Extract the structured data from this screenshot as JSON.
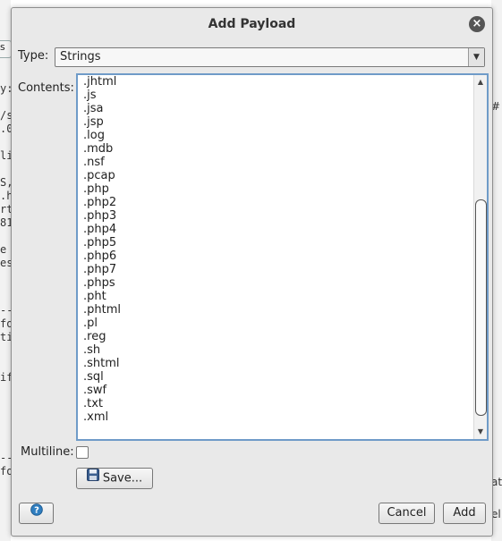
{
  "dialog": {
    "title": "Add Payload",
    "close_symbol": "×"
  },
  "type_field": {
    "label": "Type:",
    "value": "Strings",
    "arrow": "▼"
  },
  "contents": {
    "label": "Contents:",
    "items": [
      ".jhtml",
      ".js",
      ".jsa",
      ".jsp",
      ".log",
      ".mdb",
      ".nsf",
      ".pcap",
      ".php",
      ".php2",
      ".php3",
      ".php4",
      ".php5",
      ".php6",
      ".php7",
      ".phps",
      ".pht",
      ".phtml",
      ".pl",
      ".reg",
      ".sh",
      ".shtml",
      ".sql",
      ".swf",
      ".txt",
      ".xml"
    ],
    "scroll_up": "▲",
    "scroll_down": "▼",
    "scroll_fraction": 0.6
  },
  "multiline": {
    "label": "Multiline:",
    "checked": false
  },
  "buttons": {
    "save": "Save...",
    "cancel": "Cancel",
    "add": "Add"
  },
  "icons": {
    "close": "close-icon",
    "save": "floppy-disk-icon",
    "help": "help-icon",
    "dropdown": "chevron-down-icon"
  },
  "background": {
    "left_fragments": [
      "s",
      "y:",
      "/s",
      ".0",
      "",
      "li",
      "",
      "S,",
      ".h",
      "rt",
      "81",
      "",
      "e",
      "es",
      "",
      "",
      "",
      "--",
      "fo",
      "ti",
      "",
      "",
      "if",
      "",
      "",
      "",
      "",
      "--",
      "fo"
    ],
    "right_fragments": [
      "#",
      "ati",
      "el"
    ],
    "left_button": "s"
  },
  "colors": {
    "focus_border": "#6f9bc8",
    "dialog_bg": "#e9e9e9",
    "close_bg": "#555555",
    "help_icon": "#2f7ec0"
  }
}
